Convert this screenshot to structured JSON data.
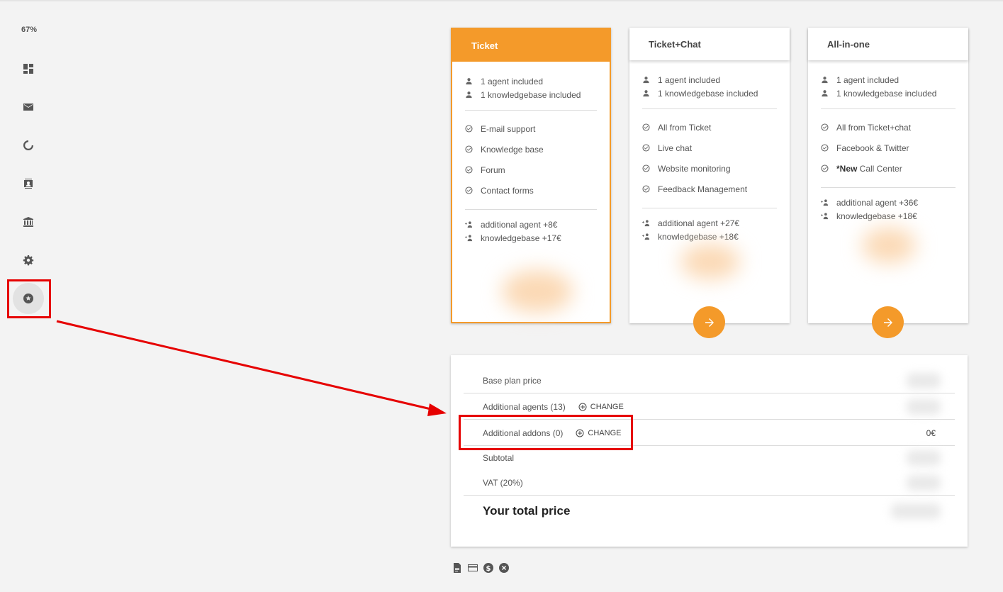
{
  "sidebar": {
    "zoom": "67%",
    "items": [
      {
        "icon": "dashboard-icon"
      },
      {
        "icon": "mail-icon"
      },
      {
        "icon": "progress-ring-icon"
      },
      {
        "icon": "contact-card-icon"
      },
      {
        "icon": "bank-icon"
      },
      {
        "icon": "gear-icon"
      },
      {
        "icon": "star-badge-icon"
      }
    ]
  },
  "plans": [
    {
      "name": "Ticket",
      "included": [
        "1 agent included",
        "1 knowledgebase included"
      ],
      "features": [
        "E-mail support",
        "Knowledge base",
        "Forum",
        "Contact forms"
      ],
      "addons": [
        "additional agent +8€",
        "knowledgebase +17€"
      ]
    },
    {
      "name": "Ticket+Chat",
      "included": [
        "1 agent included",
        "1 knowledgebase included"
      ],
      "features": [
        "All from Ticket",
        "Live chat",
        "Website monitoring",
        "Feedback Management"
      ],
      "addons": [
        "additional agent +27€",
        "knowledgebase +18€"
      ]
    },
    {
      "name": "All-in-one",
      "included": [
        "1 agent included",
        "1 knowledgebase included"
      ],
      "features": [
        "All from Ticket+chat",
        "Facebook & Twitter"
      ],
      "feature_new_prefix": "*New",
      "feature_new_rest": " Call Center",
      "addons": [
        "additional agent +36€",
        "knowledgebase +18€"
      ]
    }
  ],
  "summary": {
    "base_plan_price": "Base plan price",
    "additional_agents": "Additional agents (13)",
    "change_label": "CHANGE",
    "additional_addons": "Additional addons (0)",
    "addons_value": "0€",
    "subtotal": "Subtotal",
    "vat": "VAT (20%)",
    "total": "Your total price"
  },
  "footer_icons": [
    "document-icon",
    "credit-card-icon",
    "dollar-coin-icon",
    "cancel-circle-icon"
  ],
  "colors": {
    "accent": "#f49a2a",
    "highlight": "#e60000"
  }
}
